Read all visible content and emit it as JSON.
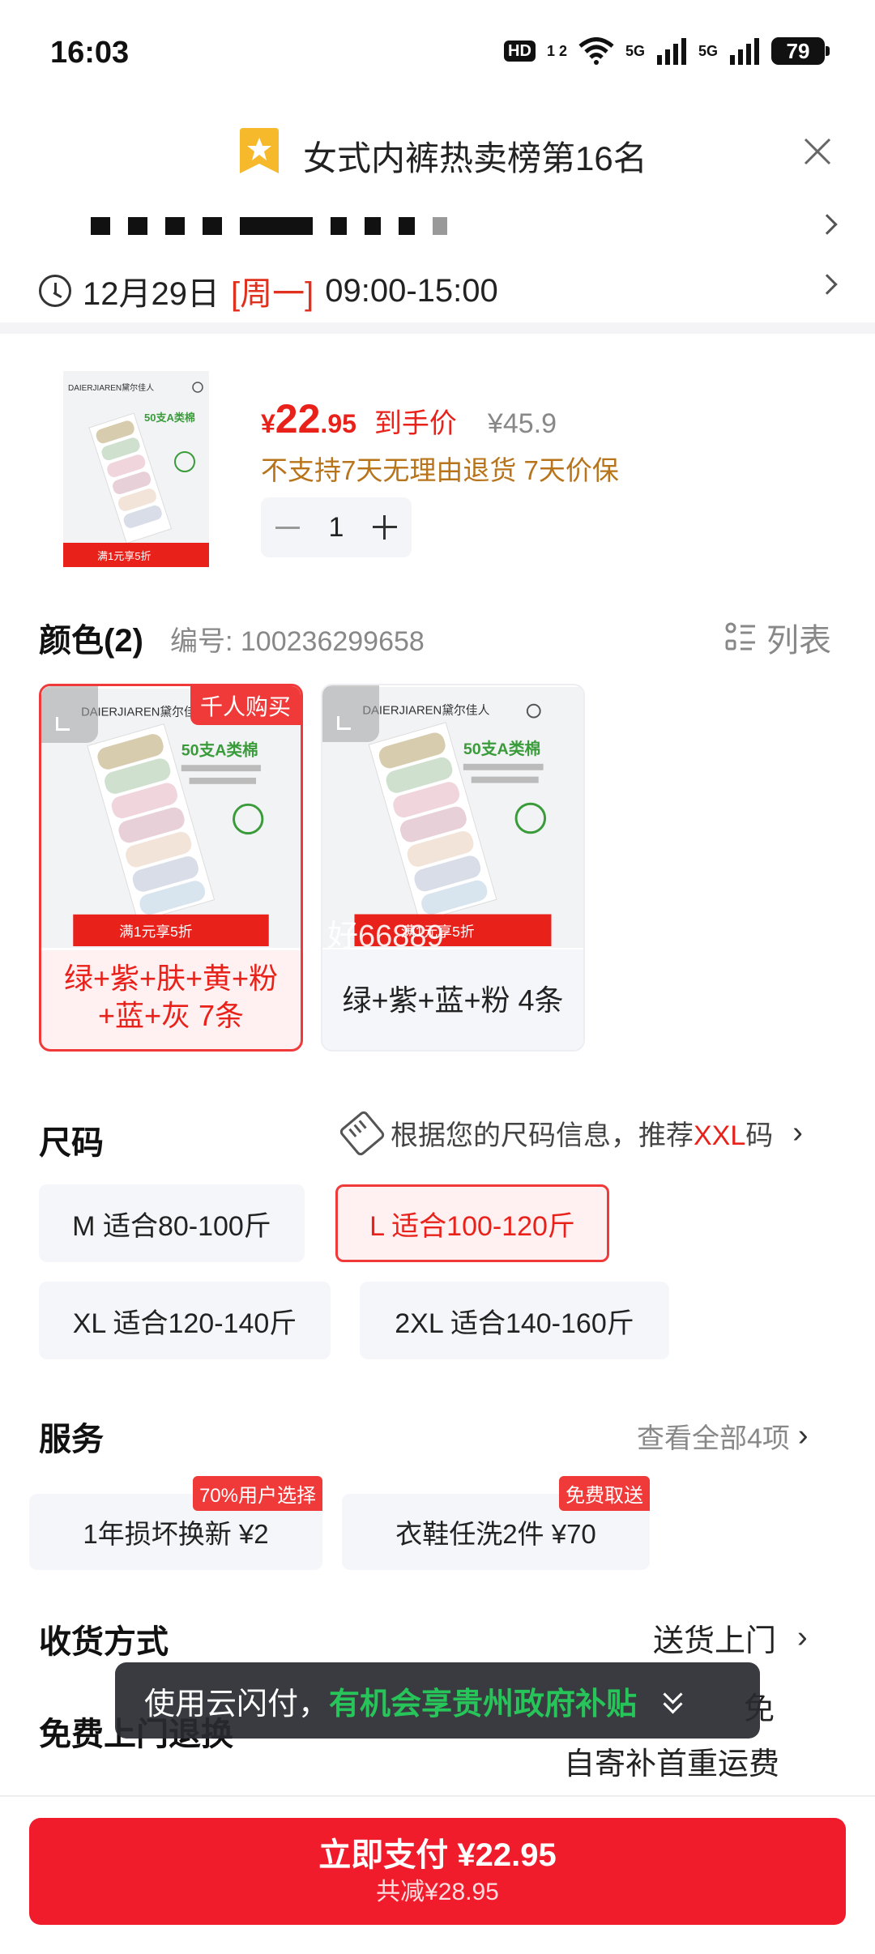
{
  "status_bar": {
    "time": "16:03",
    "hd": "HD",
    "hd_sub": "1 2",
    "net1": "5G",
    "net2": "5G",
    "battery": "79"
  },
  "ranking": {
    "text": "女式内裤热卖榜第16名",
    "badge_color": "#f6b92b"
  },
  "delivery_time": {
    "date": "12月29日",
    "weekday": "[周一]",
    "window": "09:00-15:00"
  },
  "product": {
    "currency": "¥",
    "price_int": "22",
    "price_dec": ".95",
    "price_tag": "到手价",
    "orig_price": "¥45.9",
    "policy": "不支持7天无理由退货 7天价保",
    "quantity": "1",
    "image_brand": "DAIERJIAREN黛尔佳人",
    "image_headline": "50支A类棉",
    "image_promo": "满1元享5折"
  },
  "color_section": {
    "title": "颜色(2)",
    "code": "编号: 100236299658",
    "list_label": "列表",
    "options": [
      {
        "label": "绿+紫+肤+黄+粉+蓝+灰 7条",
        "tag": "千人购买",
        "selected": true
      },
      {
        "label": "绿+紫+蓝+粉 4条",
        "watermark": "好66889",
        "selected": false
      }
    ]
  },
  "size_section": {
    "title": "尺码",
    "rec_prefix": "根据您的尺码信息，推荐",
    "rec_size": "XXL",
    "rec_suffix": "码",
    "options": [
      {
        "label": "M 适合80-100斤"
      },
      {
        "label": "L 适合100-120斤",
        "selected": true
      },
      {
        "label": "XL 适合120-140斤"
      },
      {
        "label": "2XL 适合140-160斤"
      }
    ]
  },
  "service_section": {
    "title": "服务",
    "view_all": "查看全部4项",
    "options": [
      {
        "label": "1年损坏换新  ¥2",
        "badge": "70%用户选择"
      },
      {
        "label": "衣鞋任洗2件  ¥70",
        "badge": "免费取送"
      }
    ]
  },
  "shipping": {
    "title": "收货方式",
    "value": "送货上门",
    "free_return_title": "免费上门退换",
    "free_note1": "免",
    "free_note2": "自寄补首重运费"
  },
  "toast": {
    "prefix": "使用云闪付，",
    "highlight": "有机会享贵州政府补贴"
  },
  "pay_button": {
    "main": "立即支付 ¥22.95",
    "sub": "共减¥28.95"
  },
  "colors": {
    "accent_red": "#e8221b",
    "button_red": "#f01b2b",
    "policy_gold": "#b8741a",
    "toast_green": "#27c45a"
  }
}
